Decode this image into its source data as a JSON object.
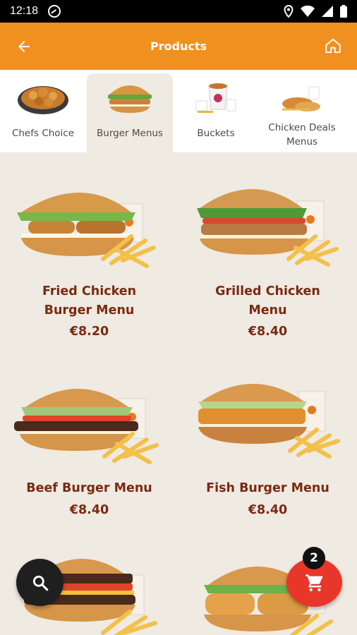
{
  "status_bar": {
    "time": "12:18"
  },
  "header": {
    "title": "Products"
  },
  "categories": [
    {
      "label": "Chefs Choice",
      "active": false
    },
    {
      "label": "Burger Menus",
      "active": true
    },
    {
      "label": "Buckets",
      "active": false
    },
    {
      "label": "Chicken Deals\nMenus",
      "active": false
    }
  ],
  "products": [
    {
      "name": "Fried Chicken\nBurger Menu",
      "price": "€8.20"
    },
    {
      "name": "Grilled Chicken\nMenu",
      "price": "€8.40"
    },
    {
      "name": "Beef Burger Menu",
      "price": "€8.40"
    },
    {
      "name": "Fish Burger Menu",
      "price": "€8.40"
    },
    {
      "name": "",
      "price": ""
    },
    {
      "name": "",
      "price": ""
    }
  ],
  "cart": {
    "count": "2"
  },
  "colors": {
    "accent": "#f0901e",
    "product_text": "#7a2a12",
    "background": "#efeae2",
    "cart_fab": "#e8362a",
    "search_fab": "#1f1f1f"
  }
}
